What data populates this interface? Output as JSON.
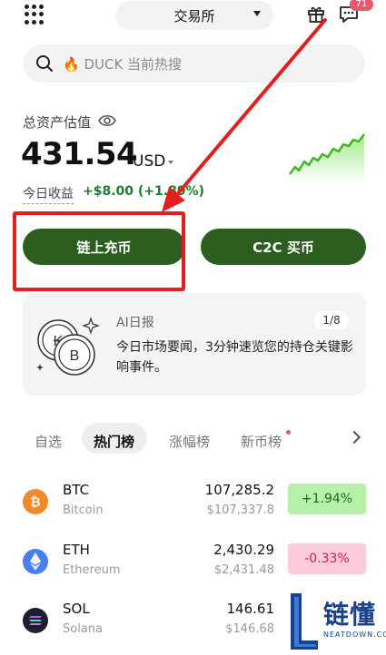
{
  "header": {
    "exchange_label": "交易所",
    "chat_badge": "71"
  },
  "search": {
    "placeholder": "🔥 DUCK 当前热搜"
  },
  "balance": {
    "label": "总资产估值",
    "amount": "431.54",
    "currency": "USD",
    "pnl_label": "今日收益",
    "pnl_value": "+$8.00 (+1.89%)"
  },
  "actions": {
    "deposit_label": "链上充币",
    "c2c_label": "C2C 买币"
  },
  "ai_report": {
    "title": "AI日报",
    "page": "1/8",
    "text": "今日市场要闻，3分钟速览您的持仓关键影响事件。"
  },
  "tabs": [
    "自选",
    "热门榜",
    "涨幅榜",
    "新币榜"
  ],
  "markets": [
    {
      "symbol": "BTC",
      "name": "Bitcoin",
      "price": "107,285.2",
      "usd": "$107,337.8",
      "change": "+1.94%",
      "icon": "bitcoin-icon",
      "color": "#f0892c"
    },
    {
      "symbol": "ETH",
      "name": "Ethereum",
      "price": "2,430.29",
      "usd": "$2,431.48",
      "change": "-0.33%",
      "icon": "ethereum-icon",
      "color": "#4a7ef0"
    },
    {
      "symbol": "SOL",
      "name": "Solana",
      "price": "146.61",
      "usd": "$146.68",
      "change": "",
      "icon": "solana-icon",
      "color": "#1e1e2e"
    }
  ],
  "watermark": {
    "brand": "链懂",
    "domain": "NEATDOWN.COM"
  },
  "colors": {
    "accent_green": "#2c5e1f",
    "positive_bg": "#b7f0a8",
    "negative_bg": "#fbcbd9",
    "annotation_red": "#e11f1f"
  }
}
